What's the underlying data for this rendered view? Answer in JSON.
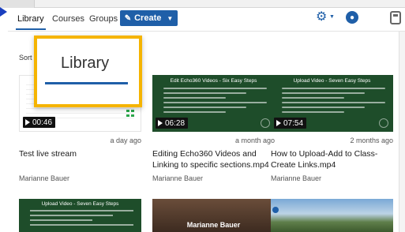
{
  "nav": {
    "tabs": [
      "Library",
      "Courses",
      "Groups"
    ],
    "create_label": "Create"
  },
  "icons": {
    "settings": "gear-icon",
    "user": "user-icon",
    "calculator": "calculator-icon"
  },
  "sort_label": "Sort",
  "highlight": {
    "title": "Library"
  },
  "cards": [
    {
      "thumb_title": "",
      "duration": "00:46",
      "age": "a day ago",
      "title": "Test live stream",
      "author": "Marianne Bauer"
    },
    {
      "thumb_title": "Edit Echo360 Videos - Six Easy Steps",
      "duration": "06:28",
      "age": "a month ago",
      "title": "Editing Echo360 Videos and Linking to specific sections.mp4",
      "author": "Marianne Bauer"
    },
    {
      "thumb_title": "Upload Video - Seven Easy Steps",
      "duration": "07:54",
      "age": "2 months ago",
      "title": "How to Upload-Add to Class-Create Links.mp4",
      "author": "Marianne Bauer"
    }
  ],
  "row2": [
    {
      "thumb_title": "Upload Video - Seven Easy Steps"
    },
    {
      "name": "Marianne Bauer"
    },
    {
      "name": ""
    }
  ],
  "colors": {
    "accent": "#1f5fa8",
    "highlight": "#f5b400",
    "thumb_green": "#1e4d2a"
  }
}
